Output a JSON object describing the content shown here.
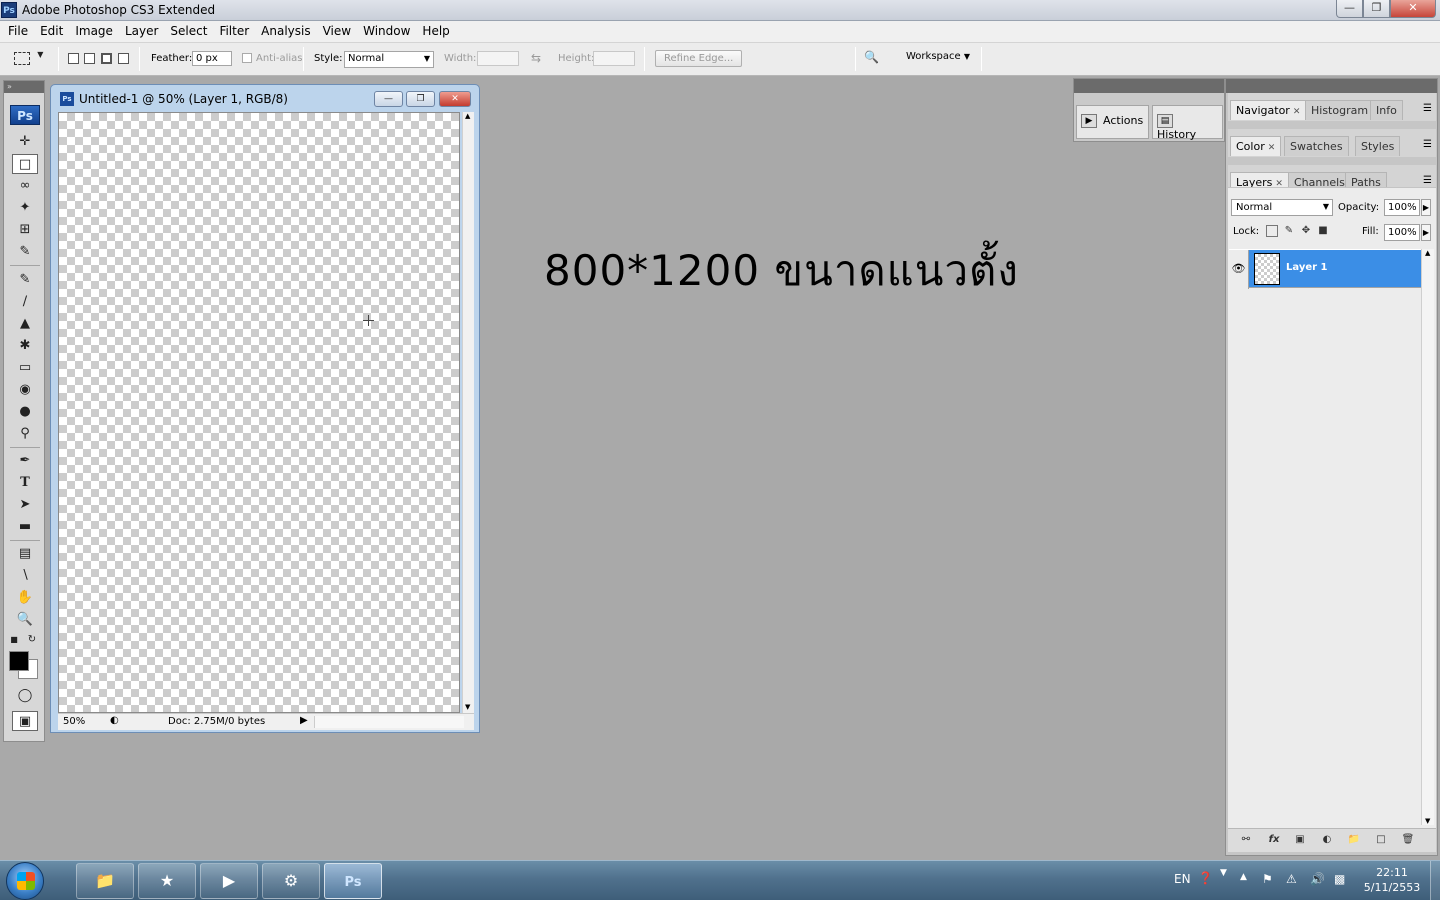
{
  "app": {
    "title": "Adobe Photoshop CS3 Extended",
    "icon_text": "Ps"
  },
  "menu": [
    "File",
    "Edit",
    "Image",
    "Layer",
    "Select",
    "Filter",
    "Analysis",
    "View",
    "Window",
    "Help"
  ],
  "options_bar": {
    "feather_label": "Feather:",
    "feather_value": "0 px",
    "antialias_label": "Anti-alias",
    "style_label": "Style:",
    "style_value": "Normal",
    "width_label": "Width:",
    "height_label": "Height:",
    "refine_edge_label": "Refine Edge...",
    "workspace_label": "Workspace"
  },
  "toolbox": {
    "logo": "Ps"
  },
  "document": {
    "title": "Untitled-1 @ 50% (Layer 1, RGB/8)",
    "icon_text": "Ps",
    "zoom": "50%",
    "doc_info": "Doc: 2.75M/0 bytes"
  },
  "annotation": "800*1200 ขนาดแนวตั้ง",
  "collapsed_panels": [
    {
      "label": "Actions"
    },
    {
      "label": "History"
    }
  ],
  "panels": {
    "group1": [
      "Navigator",
      "Histogram",
      "Info"
    ],
    "group2": [
      "Color",
      "Swatches",
      "Styles"
    ],
    "group3": [
      "Layers",
      "Channels",
      "Paths"
    ]
  },
  "layers": {
    "blend_mode": "Normal",
    "opacity_label": "Opacity:",
    "opacity": "100%",
    "lock_label": "Lock:",
    "fill_label": "Fill:",
    "fill": "100%",
    "items": [
      {
        "name": "Layer 1",
        "selected": true
      }
    ]
  },
  "taskbar": {
    "language": "EN",
    "time": "22:11",
    "date": "5/11/2553"
  },
  "colors": {
    "workspace_bg": "#a9a9a9",
    "selected_layer": "#3b8ee6",
    "foreground_color": "#000000",
    "background_color": "#ffffff"
  }
}
